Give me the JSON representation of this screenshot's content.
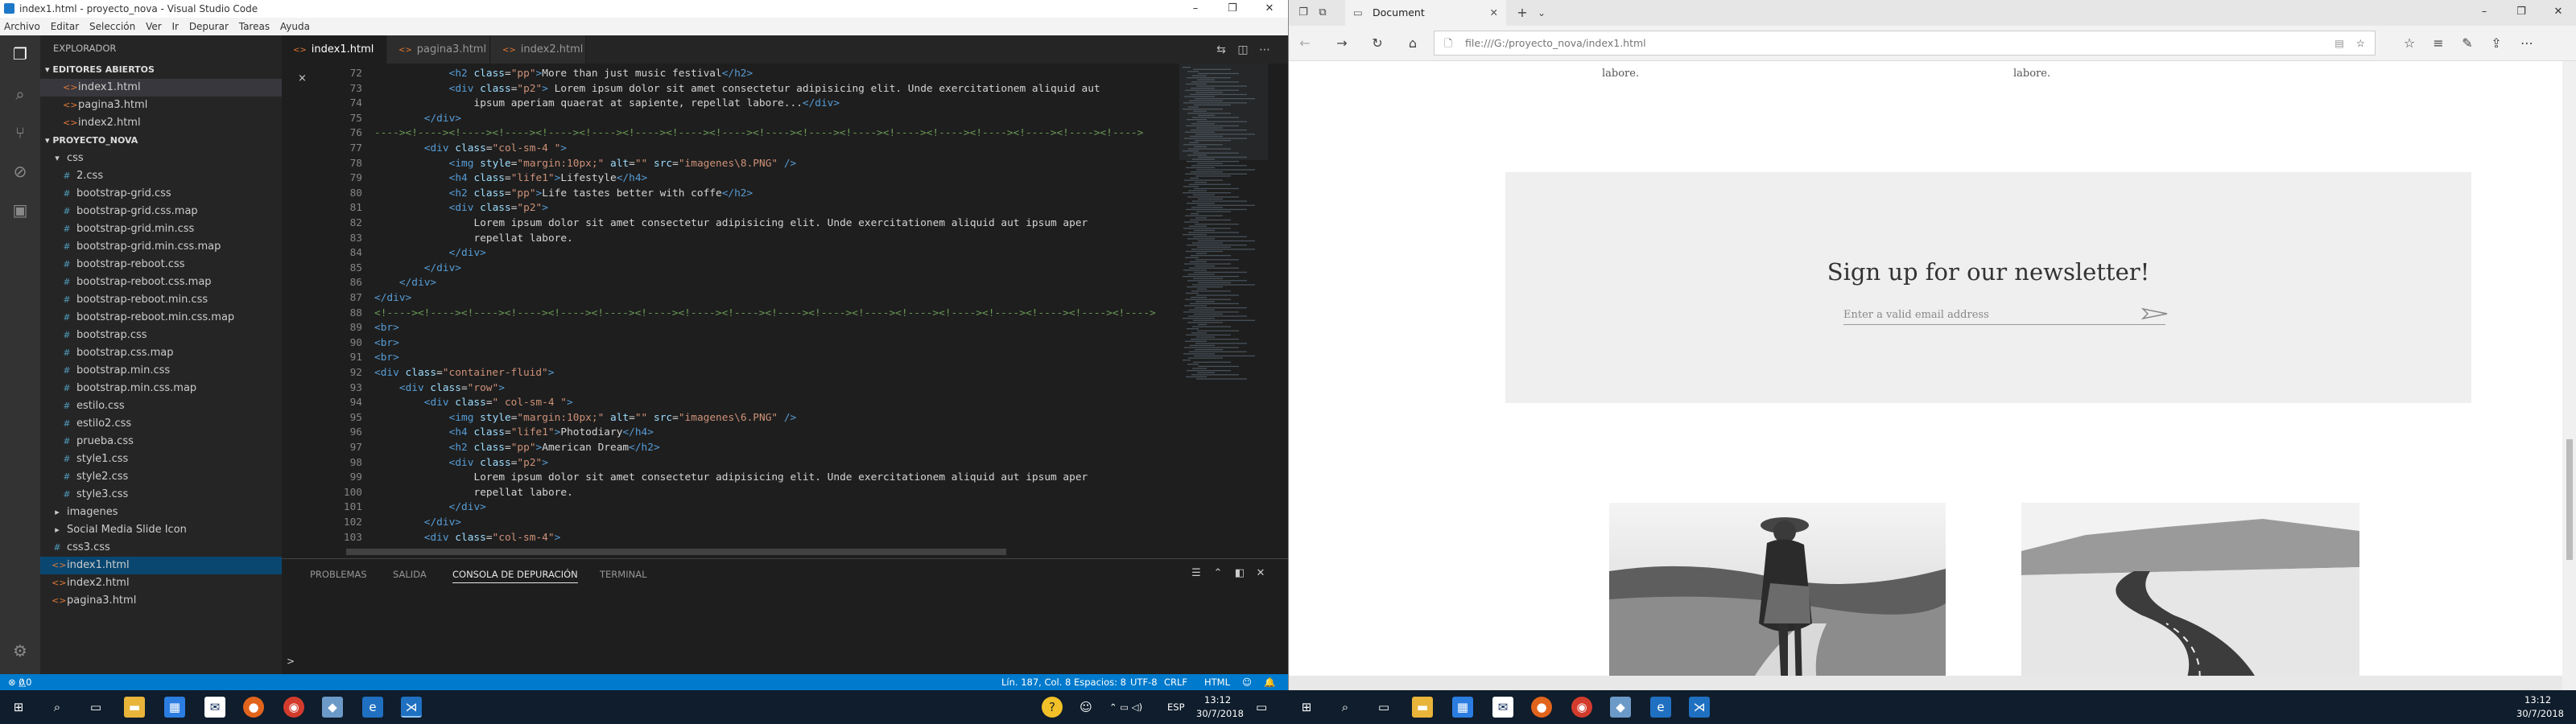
{
  "vscode": {
    "title": "index1.html - proyecto_nova - Visual Studio Code",
    "menu": [
      "Archivo",
      "Editar",
      "Selección",
      "Ver",
      "Ir",
      "Depurar",
      "Tareas",
      "Ayuda"
    ],
    "explorer_header": "EXPLORADOR",
    "open_editors_header": "EDITORES ABIERTOS",
    "open_editors": [
      "index1.html",
      "pagina3.html",
      "index2.html"
    ],
    "project_header": "PROYECTO_NOVA",
    "tree": [
      {
        "name": "css",
        "kind": "folder-open",
        "indent": 1
      },
      {
        "name": "2.css",
        "kind": "css",
        "indent": 2
      },
      {
        "name": "bootstrap-grid.css",
        "kind": "css",
        "indent": 2
      },
      {
        "name": "bootstrap-grid.css.map",
        "kind": "css",
        "indent": 2
      },
      {
        "name": "bootstrap-grid.min.css",
        "kind": "css",
        "indent": 2
      },
      {
        "name": "bootstrap-grid.min.css.map",
        "kind": "css",
        "indent": 2
      },
      {
        "name": "bootstrap-reboot.css",
        "kind": "css",
        "indent": 2
      },
      {
        "name": "bootstrap-reboot.css.map",
        "kind": "css",
        "indent": 2
      },
      {
        "name": "bootstrap-reboot.min.css",
        "kind": "css",
        "indent": 2
      },
      {
        "name": "bootstrap-reboot.min.css.map",
        "kind": "css",
        "indent": 2
      },
      {
        "name": "bootstrap.css",
        "kind": "css",
        "indent": 2
      },
      {
        "name": "bootstrap.css.map",
        "kind": "css",
        "indent": 2
      },
      {
        "name": "bootstrap.min.css",
        "kind": "css",
        "indent": 2
      },
      {
        "name": "bootstrap.min.css.map",
        "kind": "css",
        "indent": 2
      },
      {
        "name": "estilo.css",
        "kind": "css",
        "indent": 2
      },
      {
        "name": "estilo2.css",
        "kind": "css",
        "indent": 2
      },
      {
        "name": "prueba.css",
        "kind": "css",
        "indent": 2
      },
      {
        "name": "style1.css",
        "kind": "css",
        "indent": 2
      },
      {
        "name": "style2.css",
        "kind": "css",
        "indent": 2
      },
      {
        "name": "style3.css",
        "kind": "css",
        "indent": 2
      },
      {
        "name": "imagenes",
        "kind": "folder",
        "indent": 1
      },
      {
        "name": "Social Media Slide Icon",
        "kind": "folder",
        "indent": 1
      },
      {
        "name": "css3.css",
        "kind": "css",
        "indent": 1
      },
      {
        "name": "index1.html",
        "kind": "html",
        "indent": 1,
        "active": true
      },
      {
        "name": "index2.html",
        "kind": "html",
        "indent": 1
      },
      {
        "name": "pagina3.html",
        "kind": "html",
        "indent": 1
      }
    ],
    "tabs": [
      {
        "label": "index1.html",
        "active": true,
        "close": "×"
      },
      {
        "label": "pagina3.html",
        "active": false
      },
      {
        "label": "index2.html",
        "active": false
      }
    ],
    "code": [
      {
        "n": "72",
        "i": 12,
        "t": [
          [
            "tg",
            "<h2 "
          ],
          [
            "at",
            "class"
          ],
          [
            "tx",
            "="
          ],
          [
            "st",
            "\"pp\""
          ],
          [
            "tg",
            ">"
          ],
          [
            "tx",
            "More than just music festival"
          ],
          [
            "tg",
            "</h2>"
          ]
        ]
      },
      {
        "n": "73",
        "i": 12,
        "t": [
          [
            "tg",
            "<div "
          ],
          [
            "at",
            "class"
          ],
          [
            "tx",
            "="
          ],
          [
            "st",
            "\"p2\""
          ],
          [
            "tg",
            ">"
          ],
          [
            "tx",
            " Lorem ipsum dolor sit amet consectetur adipisicing elit. Unde exercitationem aliquid aut"
          ]
        ]
      },
      {
        "n": "74",
        "i": 16,
        "t": [
          [
            "tx",
            "ipsum aperiam quaerat at sapiente, repellat labore..."
          ],
          [
            "tg",
            "</div>"
          ]
        ]
      },
      {
        "n": "75",
        "i": 8,
        "t": [
          [
            "tg",
            "</div>"
          ]
        ]
      },
      {
        "n": "76",
        "i": 0,
        "t": [
          [
            "cm",
            "----><!----><!----><!----><!----><!----><!----><!----><!----><!----><!----><!----><!----><!----><!----><!----><!----><!---->"
          ]
        ]
      },
      {
        "n": "77",
        "i": 8,
        "t": [
          [
            "tg",
            "<div "
          ],
          [
            "at",
            "class"
          ],
          [
            "tx",
            "="
          ],
          [
            "st",
            "\"col-sm-4 \""
          ],
          [
            "tg",
            ">"
          ]
        ]
      },
      {
        "n": "78",
        "i": 12,
        "t": [
          [
            "tg",
            "<img "
          ],
          [
            "at",
            "style"
          ],
          [
            "tx",
            "="
          ],
          [
            "st",
            "\"margin:10px;\""
          ],
          [
            "tx",
            " "
          ],
          [
            "at",
            "alt"
          ],
          [
            "tx",
            "="
          ],
          [
            "st",
            "\"\""
          ],
          [
            "tx",
            " "
          ],
          [
            "at",
            "src"
          ],
          [
            "tx",
            "="
          ],
          [
            "st",
            "\"imagenes\\8.PNG\""
          ],
          [
            "tx",
            " "
          ],
          [
            "tg",
            "/>"
          ]
        ]
      },
      {
        "n": "79",
        "i": 12,
        "t": [
          [
            "tg",
            "<h4 "
          ],
          [
            "at",
            "class"
          ],
          [
            "tx",
            "="
          ],
          [
            "st",
            "\"life1\""
          ],
          [
            "tg",
            ">"
          ],
          [
            "tx",
            "Lifestyle"
          ],
          [
            "tg",
            "</h4>"
          ]
        ]
      },
      {
        "n": "80",
        "i": 12,
        "t": [
          [
            "tg",
            "<h2 "
          ],
          [
            "at",
            "class"
          ],
          [
            "tx",
            "="
          ],
          [
            "st",
            "\"pp\""
          ],
          [
            "tg",
            ">"
          ],
          [
            "tx",
            "Life tastes better with coffe"
          ],
          [
            "tg",
            "</h2>"
          ]
        ]
      },
      {
        "n": "81",
        "i": 12,
        "t": [
          [
            "tg",
            "<div "
          ],
          [
            "at",
            "class"
          ],
          [
            "tx",
            "="
          ],
          [
            "st",
            "\"p2\""
          ],
          [
            "tg",
            ">"
          ]
        ]
      },
      {
        "n": "82",
        "i": 16,
        "t": [
          [
            "tx",
            "Lorem ipsum dolor sit amet consectetur adipisicing elit. Unde exercitationem aliquid aut ipsum aper"
          ]
        ]
      },
      {
        "n": "83",
        "i": 16,
        "t": [
          [
            "tx",
            "repellat labore."
          ]
        ]
      },
      {
        "n": "84",
        "i": 12,
        "t": [
          [
            "tg",
            "</div>"
          ]
        ]
      },
      {
        "n": "85",
        "i": 8,
        "t": [
          [
            "tg",
            "</div>"
          ]
        ]
      },
      {
        "n": "86",
        "i": 4,
        "t": [
          [
            "tg",
            "</div>"
          ]
        ]
      },
      {
        "n": "87",
        "i": 0,
        "t": [
          [
            "tg",
            "</div>"
          ]
        ]
      },
      {
        "n": "88",
        "i": 0,
        "t": [
          [
            "cm",
            "<!----><!----><!----><!----><!----><!----><!----><!----><!----><!----><!----><!----><!----><!----><!----><!----><!----><!---->"
          ]
        ]
      },
      {
        "n": "89",
        "i": 0,
        "t": [
          [
            "tg",
            "<br>"
          ]
        ]
      },
      {
        "n": "90",
        "i": 0,
        "t": [
          [
            "tg",
            "<br>"
          ]
        ]
      },
      {
        "n": "91",
        "i": 0,
        "t": [
          [
            "tg",
            "<br>"
          ]
        ]
      },
      {
        "n": "92",
        "i": 0,
        "t": [
          [
            "tg",
            "<div "
          ],
          [
            "at",
            "class"
          ],
          [
            "tx",
            "="
          ],
          [
            "st",
            "\"container-fluid\""
          ],
          [
            "tg",
            ">"
          ]
        ]
      },
      {
        "n": "93",
        "i": 4,
        "t": [
          [
            "tg",
            "<div "
          ],
          [
            "at",
            "class"
          ],
          [
            "tx",
            "="
          ],
          [
            "st",
            "\"row\""
          ],
          [
            "tg",
            ">"
          ]
        ]
      },
      {
        "n": "94",
        "i": 8,
        "t": [
          [
            "tg",
            "<div "
          ],
          [
            "at",
            "class"
          ],
          [
            "tx",
            "="
          ],
          [
            "st",
            "\" col-sm-4 \""
          ],
          [
            "tg",
            ">"
          ]
        ]
      },
      {
        "n": "95",
        "i": 12,
        "t": [
          [
            "tg",
            "<img "
          ],
          [
            "at",
            "style"
          ],
          [
            "tx",
            "="
          ],
          [
            "st",
            "\"margin:10px;\""
          ],
          [
            "tx",
            " "
          ],
          [
            "at",
            "alt"
          ],
          [
            "tx",
            "="
          ],
          [
            "st",
            "\"\""
          ],
          [
            "tx",
            " "
          ],
          [
            "at",
            "src"
          ],
          [
            "tx",
            "="
          ],
          [
            "st",
            "\"imagenes\\6.PNG\""
          ],
          [
            "tx",
            " "
          ],
          [
            "tg",
            "/>"
          ]
        ]
      },
      {
        "n": "96",
        "i": 12,
        "t": [
          [
            "tg",
            "<h4 "
          ],
          [
            "at",
            "class"
          ],
          [
            "tx",
            "="
          ],
          [
            "st",
            "\"life1\""
          ],
          [
            "tg",
            ">"
          ],
          [
            "tx",
            "Photodiary"
          ],
          [
            "tg",
            "</h4>"
          ]
        ]
      },
      {
        "n": "97",
        "i": 12,
        "t": [
          [
            "tg",
            "<h2 "
          ],
          [
            "at",
            "class"
          ],
          [
            "tx",
            "="
          ],
          [
            "st",
            "\"pp\""
          ],
          [
            "tg",
            ">"
          ],
          [
            "tx",
            "American Dream"
          ],
          [
            "tg",
            "</h2>"
          ]
        ]
      },
      {
        "n": "98",
        "i": 12,
        "t": [
          [
            "tg",
            "<div "
          ],
          [
            "at",
            "class"
          ],
          [
            "tx",
            "="
          ],
          [
            "st",
            "\"p2\""
          ],
          [
            "tg",
            ">"
          ]
        ]
      },
      {
        "n": "99",
        "i": 16,
        "t": [
          [
            "tx",
            "Lorem ipsum dolor sit amet consectetur adipisicing elit. Unde exercitationem aliquid aut ipsum aper"
          ]
        ]
      },
      {
        "n": "100",
        "i": 16,
        "t": [
          [
            "tx",
            "repellat labore."
          ]
        ]
      },
      {
        "n": "101",
        "i": 12,
        "t": [
          [
            "tg",
            "</div>"
          ]
        ]
      },
      {
        "n": "102",
        "i": 8,
        "t": [
          [
            "tg",
            "</div>"
          ]
        ]
      },
      {
        "n": "103",
        "i": 8,
        "t": [
          [
            "tg",
            "<div "
          ],
          [
            "at",
            "class"
          ],
          [
            "tx",
            "="
          ],
          [
            "st",
            "\"col-sm-4\""
          ],
          [
            "tg",
            ">"
          ]
        ]
      }
    ],
    "panel_tabs": [
      {
        "label": "PROBLEMAS",
        "active": false
      },
      {
        "label": "SALIDA",
        "active": false
      },
      {
        "label": "CONSOLA DE DEPURACIÓN",
        "active": true
      },
      {
        "label": "TERMINAL",
        "active": false
      }
    ],
    "panel_prompt": ">",
    "status": {
      "errors": "0",
      "warnings": "0",
      "position": "Lín. 187, Col. 8",
      "spaces": "Espacios: 8",
      "encoding": "UTF-8",
      "eol": "CRLF",
      "language": "HTML"
    }
  },
  "browser": {
    "tab_title": "Document",
    "url": "file:///G:/proyecto_nova/index1.html",
    "text_left": "labore.",
    "text_right": "labore.",
    "newsletter_title": "Sign up for our newsletter!",
    "email_placeholder": "Enter a valid email address"
  },
  "taskbar": {
    "lang": "ESP",
    "time": "13:12",
    "date": "30/7/2018"
  },
  "colors": {
    "vs_status": "#007acc",
    "accent_blue": "#007acc",
    "html_icon": "#e37933",
    "css_icon": "#519aba"
  }
}
